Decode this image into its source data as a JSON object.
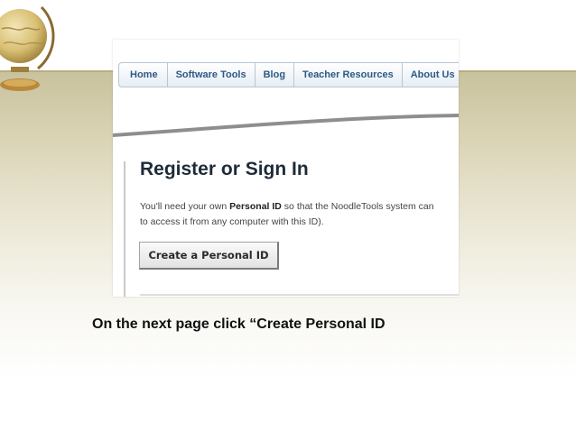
{
  "nav": {
    "tabs": [
      "Home",
      "Software Tools",
      "Blog",
      "Teacher Resources",
      "About Us"
    ]
  },
  "main": {
    "heading": "Register or Sign In",
    "line1_pre": "You'll need your own ",
    "line1_bold": "Personal ID",
    "line1_post": " so that the NoodleTools system can",
    "line2": "to access it from any computer with this ID).",
    "create_button": "Create a Personal ID"
  },
  "caption": "On the next page click “Create Personal ID",
  "icons": [
    "globe-icon"
  ],
  "colors": {
    "nav_text": "#2c5a85",
    "slide_band": "#c9c29e"
  }
}
